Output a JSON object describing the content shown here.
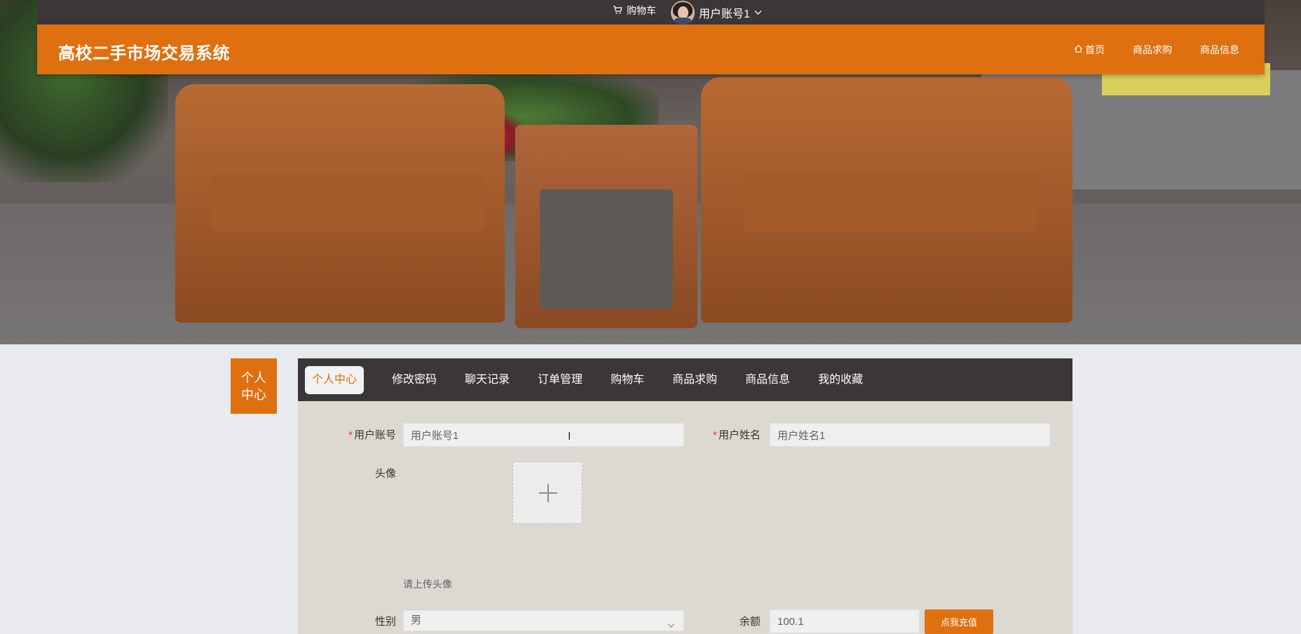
{
  "topbar": {
    "cart_label": "购物车",
    "username": "用户账号1"
  },
  "header": {
    "title": "高校二手市场交易系统",
    "nav": [
      {
        "label": "首页"
      },
      {
        "label": "商品求购"
      },
      {
        "label": "商品信息"
      }
    ]
  },
  "side_tag": {
    "label_line1": "个人",
    "label_line2": "中心"
  },
  "tabs": [
    {
      "label": "个人中心",
      "active": true
    },
    {
      "label": "修改密码"
    },
    {
      "label": "聊天记录"
    },
    {
      "label": "订单管理"
    },
    {
      "label": "购物车"
    },
    {
      "label": "商品求购"
    },
    {
      "label": "商品信息"
    },
    {
      "label": "我的收藏"
    }
  ],
  "form": {
    "account_label": "用户账号",
    "account_value": "用户账号1",
    "name_label": "用户姓名",
    "name_value": "用户姓名1",
    "avatar_label": "头像",
    "avatar_hint": "请上传头像",
    "gender_label": "性别",
    "gender_value": "男",
    "balance_label": "余额",
    "balance_value": "100.1",
    "recharge_label": "点我充值"
  },
  "colors": {
    "accent": "#df7010",
    "dark": "#3b3739",
    "panel": "#dcd9d2"
  }
}
